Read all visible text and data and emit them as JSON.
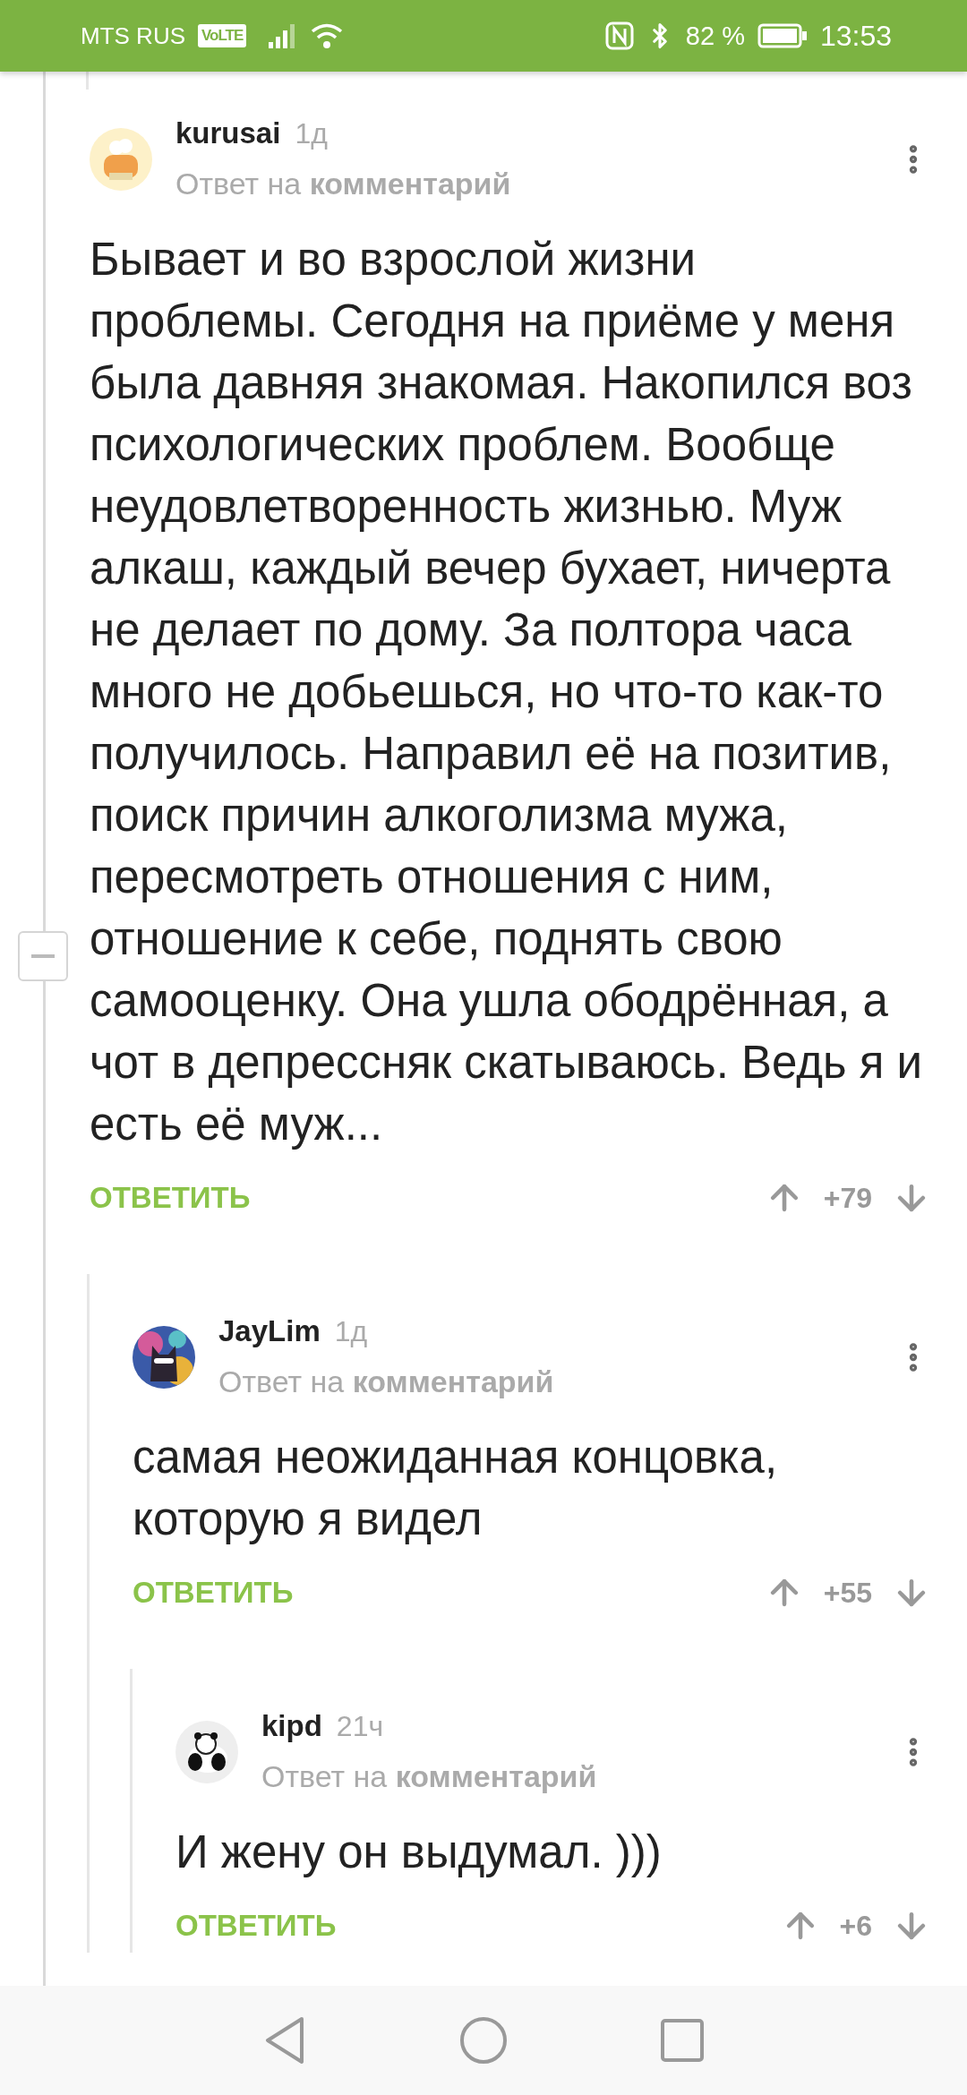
{
  "status_bar": {
    "carrier": "MTS RUS",
    "network_badge": "VoLTE",
    "battery": "82 %",
    "time": "13:53"
  },
  "comments": [
    {
      "author": "kurusai",
      "age": "1д",
      "reply_prefix": "Ответ на",
      "reply_target": "комментарий",
      "text": "Бывает и во взрослой жизни проблемы. Сегодня на приёме у меня была давняя знакомая. Накопился воз психологических проблем. Вообще неудовлетворенность жизнью. Муж алкаш, каждый вечер бухает, ничерта не делает по дому. За полтора часа много не добьешься, но что-то как-то получилось. Направил её на позитив, поиск причин алкоголизма мужа, пересмотреть отношения с ним, отношение к себе, поднять свою самооценку. Она ушла ободрённая, а чот в депрессняк скатываюсь. Ведь я и есть её муж...",
      "reply_label": "ОТВЕТИТЬ",
      "score": "+79",
      "collapsed": false,
      "children": [
        {
          "author": "JayLim",
          "age": "1д",
          "reply_prefix": "Ответ на",
          "reply_target": "комментарий",
          "text": "самая неожиданная концовка, которую я видел",
          "reply_label": "ОТВЕТИТЬ",
          "score": "+55",
          "children": [
            {
              "author": "kipd",
              "age": "21ч",
              "reply_prefix": "Ответ на",
              "reply_target": "комментарий",
              "text": "И жену он выдумал. )))",
              "reply_label": "ОТВЕТИТЬ",
              "score": "+6"
            }
          ]
        }
      ]
    }
  ]
}
